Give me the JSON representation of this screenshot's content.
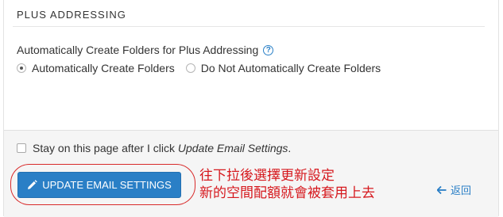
{
  "section": {
    "title": "PLUS ADDRESSING"
  },
  "setting": {
    "label": "Automatically Create Folders for Plus Addressing",
    "options": [
      {
        "label": "Automatically Create Folders",
        "selected": true
      },
      {
        "label": "Do Not Automatically Create Folders",
        "selected": false
      }
    ]
  },
  "footer": {
    "stay_prefix": "Stay on this page after I click ",
    "stay_emphasis": "Update Email Settings",
    "stay_suffix": ".",
    "stay_checked": false,
    "update_button": "UPDATE EMAIL SETTINGS",
    "back_label": "返回"
  },
  "annotation": {
    "line1": "往下拉後選擇更新設定",
    "line2": "新的空間配額就會被套用上去",
    "color": "#d6191e"
  },
  "colors": {
    "accent": "#2a7fc6",
    "annotation_ring": "#d82a2a"
  }
}
